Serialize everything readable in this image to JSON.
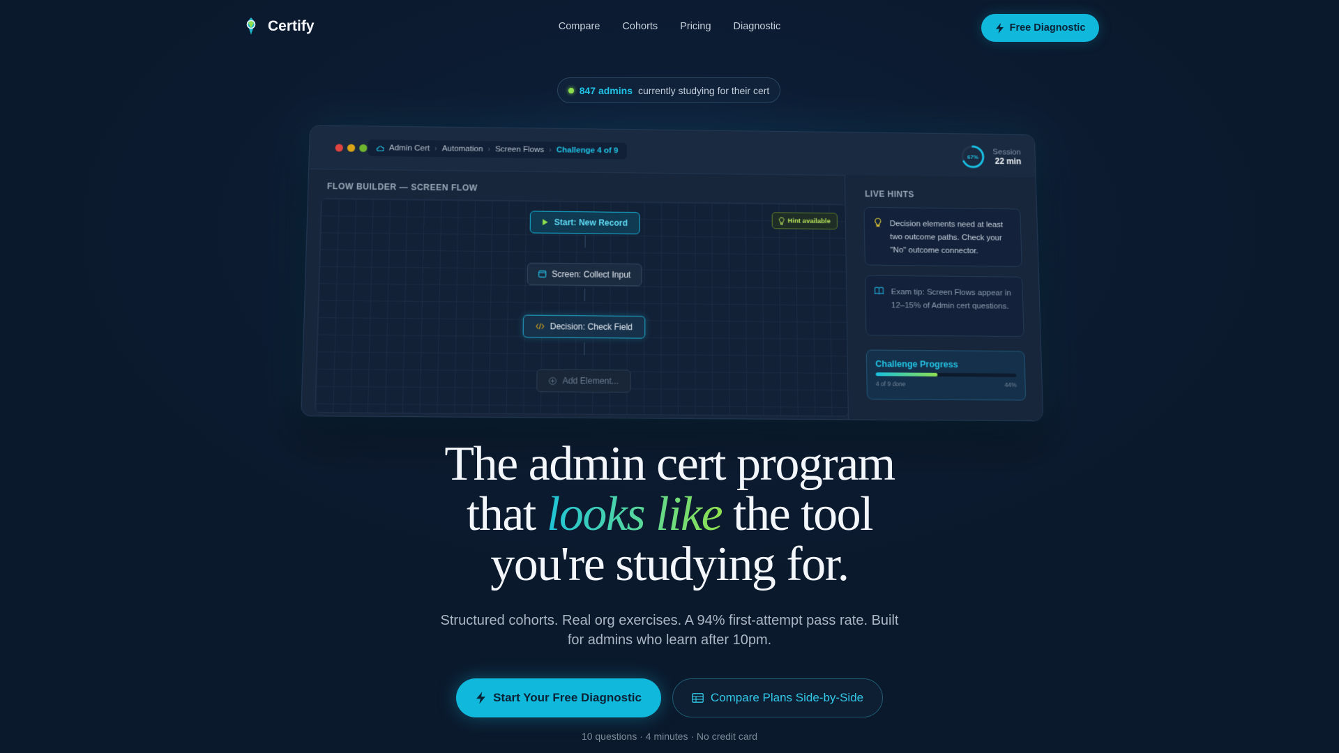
{
  "nav": {
    "brand": "Certify",
    "links": [
      "Compare",
      "Cohorts",
      "Pricing",
      "Diagnostic"
    ],
    "cta": "Free Diagnostic"
  },
  "status": {
    "count": "847 admins",
    "text": "currently studying for their cert"
  },
  "mock": {
    "breadcrumb": [
      "Admin Cert",
      "Automation",
      "Screen Flows",
      "Challenge 4 of 9"
    ],
    "session": {
      "ring_label": "67%",
      "ring_fraction": 0.67,
      "label": "Session",
      "value": "22 min"
    },
    "flow_title": "FLOW BUILDER — SCREEN FLOW",
    "hint_badge": "Hint available",
    "nodes": {
      "start": "Start: New Record",
      "screen": "Screen: Collect Input",
      "decision": "Decision: Check Field",
      "add": "Add Element..."
    },
    "hints_title": "LIVE HINTS",
    "hint_1": "Decision elements need at least two outcome paths. Check your \"No\" outcome connector.",
    "hint_2": "Exam tip: Screen Flows appear in 12–15% of Admin cert questions.",
    "progress": {
      "title": "Challenge Progress",
      "done": "4 of 9 done",
      "percent_label": "44%",
      "fraction": 0.44
    }
  },
  "hero": {
    "line1": "The admin cert program",
    "line2_pre": "that ",
    "line2_accent": "looks like",
    "line2_post": " the tool",
    "line3": "you're studying for.",
    "subtitle": "Structured cohorts. Real org exercises. A 94% first-attempt pass rate. Built for admins who learn after 10pm.",
    "primary_cta": "Start Your Free Diagnostic",
    "secondary_cta": "Compare Plans Side-by-Side",
    "note": "10 questions · 4 minutes · No credit card"
  },
  "colors": {
    "accent": "#10b8dc",
    "lime": "#8ee04e",
    "background": "#0b192c"
  },
  "icons": [
    "certify-logo-icon",
    "bolt-icon",
    "play-icon",
    "screen-icon",
    "decision-icon",
    "plus-circle-icon",
    "lightbulb-icon",
    "book-icon",
    "table-icon"
  ]
}
